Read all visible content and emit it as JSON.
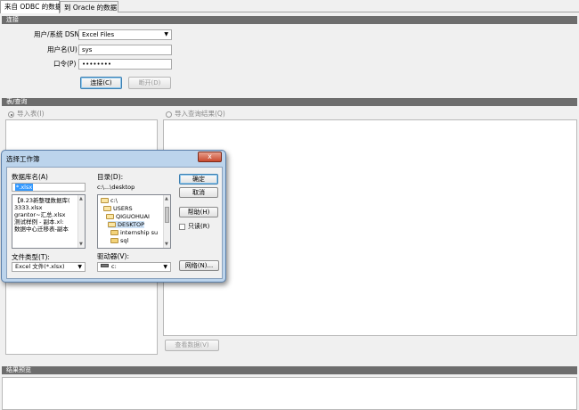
{
  "tabs": [
    {
      "label": "来自 ODBC 的数据",
      "active": true
    },
    {
      "label": "到 Oracle 的数据",
      "active": false
    }
  ],
  "connection": {
    "section_title": "连接",
    "dsn_label": "用户/系统 DSN",
    "dsn_value": "Excel Files",
    "username_label": "用户名(U)",
    "username_value": "sys",
    "password_label": "口令(P)",
    "password_value": "••••••••",
    "connect_button": "连接(C)",
    "disconnect_button": "断开(D)"
  },
  "table_query": {
    "section_title": "表/查询",
    "import_table_label": "导入表(I)",
    "import_query_label": "导入查询结果(Q)",
    "view_data_button": "查看数据(V)"
  },
  "results": {
    "section_title": "结果预览"
  },
  "dialog": {
    "title": "选择工作簿",
    "close_glyph": "x",
    "db_name_label": "数据库名(A)",
    "db_name_value": "*.xlsx",
    "files": [
      "【8.23新整理数据库(",
      "3333.xlsx",
      "grantor~汇总.xlsx",
      "测试样例 - 副本.xl:",
      "数据中心迁移表-副本"
    ],
    "dir_label": "目录(D):",
    "dir_path": "c:\\...\\desktop",
    "folders": [
      {
        "name": "c:\\",
        "open": true
      },
      {
        "name": "USERS",
        "open": true
      },
      {
        "name": "QIGUOHUAI",
        "open": true
      },
      {
        "name": "DESKTOP",
        "open": true
      },
      {
        "name": "internship su",
        "open": false
      },
      {
        "name": "sql",
        "open": false
      }
    ],
    "file_type_label": "文件类型(T):",
    "file_type_value": "Excel 文件(*.xlsx)",
    "drive_label": "驱动器(V):",
    "drive_value": "c:",
    "ok_button": "确定",
    "cancel_button": "取消",
    "help_button": "帮助(H)",
    "readonly_label": "只读(R)",
    "network_button": "网络(N)..."
  }
}
